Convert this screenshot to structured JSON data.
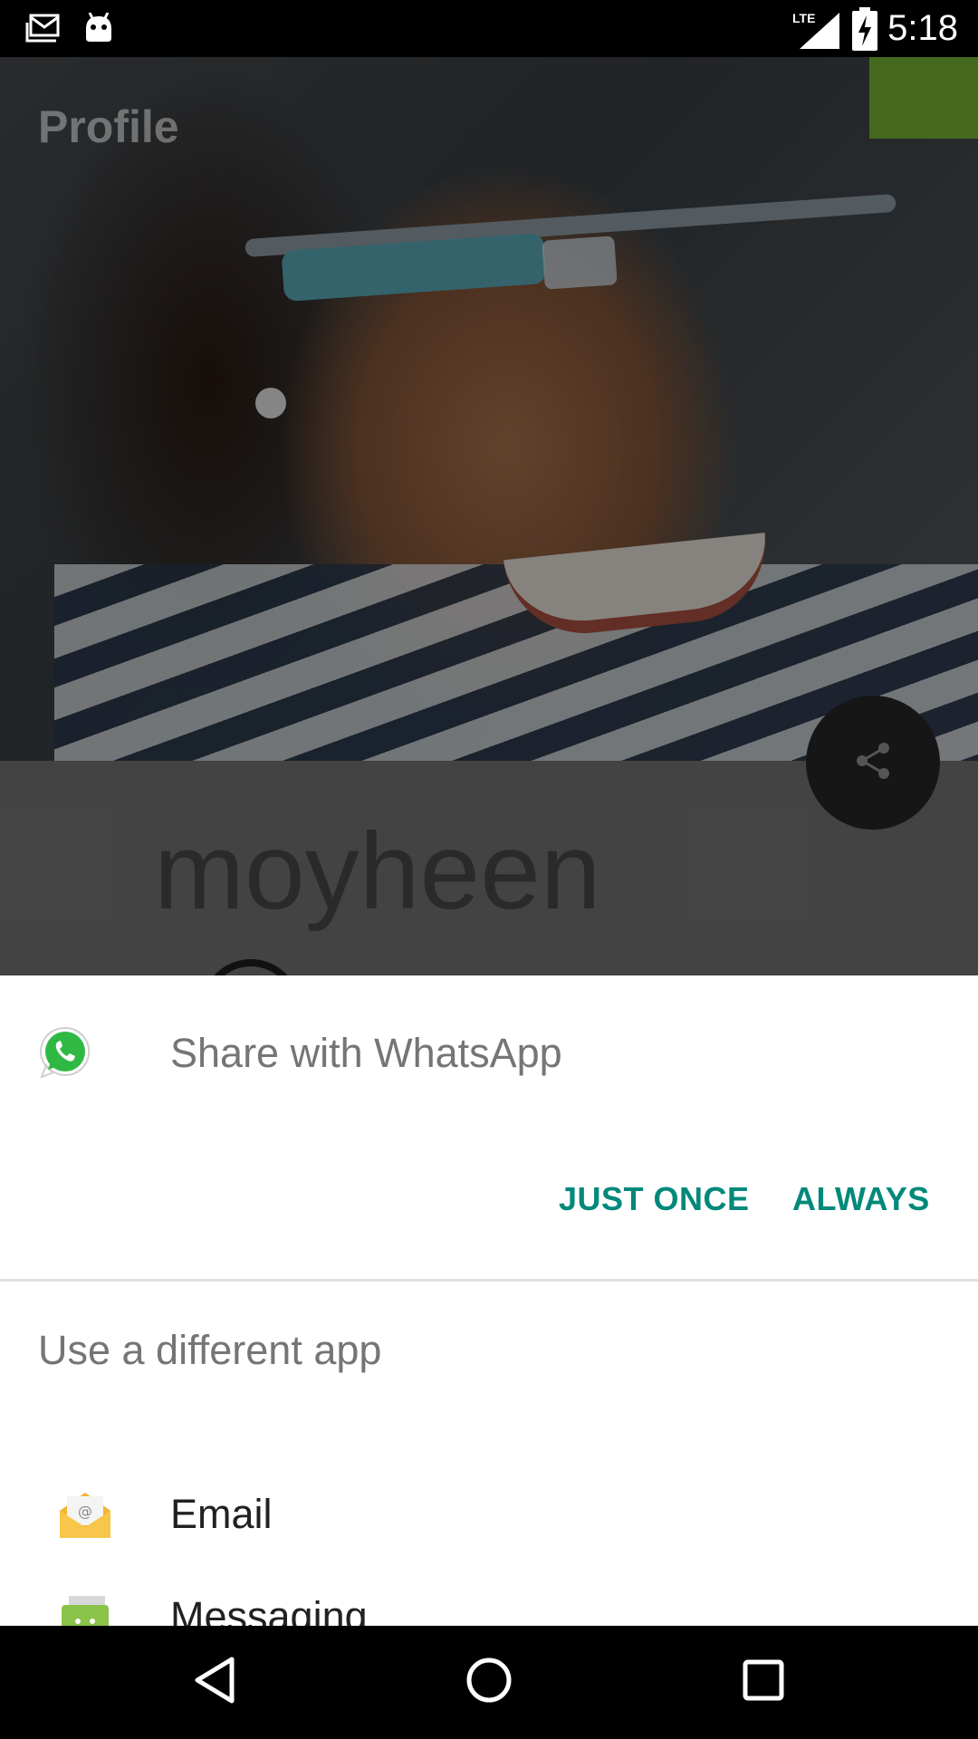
{
  "status_bar": {
    "network_label": "LTE",
    "time": "5:18",
    "icons": [
      "email-notification-icon",
      "android-notification-icon",
      "lte-signal-icon",
      "battery-charging-icon"
    ]
  },
  "background_app": {
    "title": "Profile",
    "user_name": "moyheen",
    "share_fab_icon": "share-icon"
  },
  "chooser": {
    "share_title": "Share with WhatsApp",
    "share_app_icon": "whatsapp-icon",
    "just_once_label": "JUST ONCE",
    "always_label": "ALWAYS",
    "other_apps_title": "Use a different app",
    "apps": [
      {
        "label": "Email",
        "icon": "email-app-icon"
      },
      {
        "label": "Messaging",
        "icon": "messaging-app-icon"
      }
    ],
    "accent_color": "#00897b"
  },
  "nav_bar": {
    "icons": [
      "back-icon",
      "home-icon",
      "recents-icon"
    ]
  }
}
